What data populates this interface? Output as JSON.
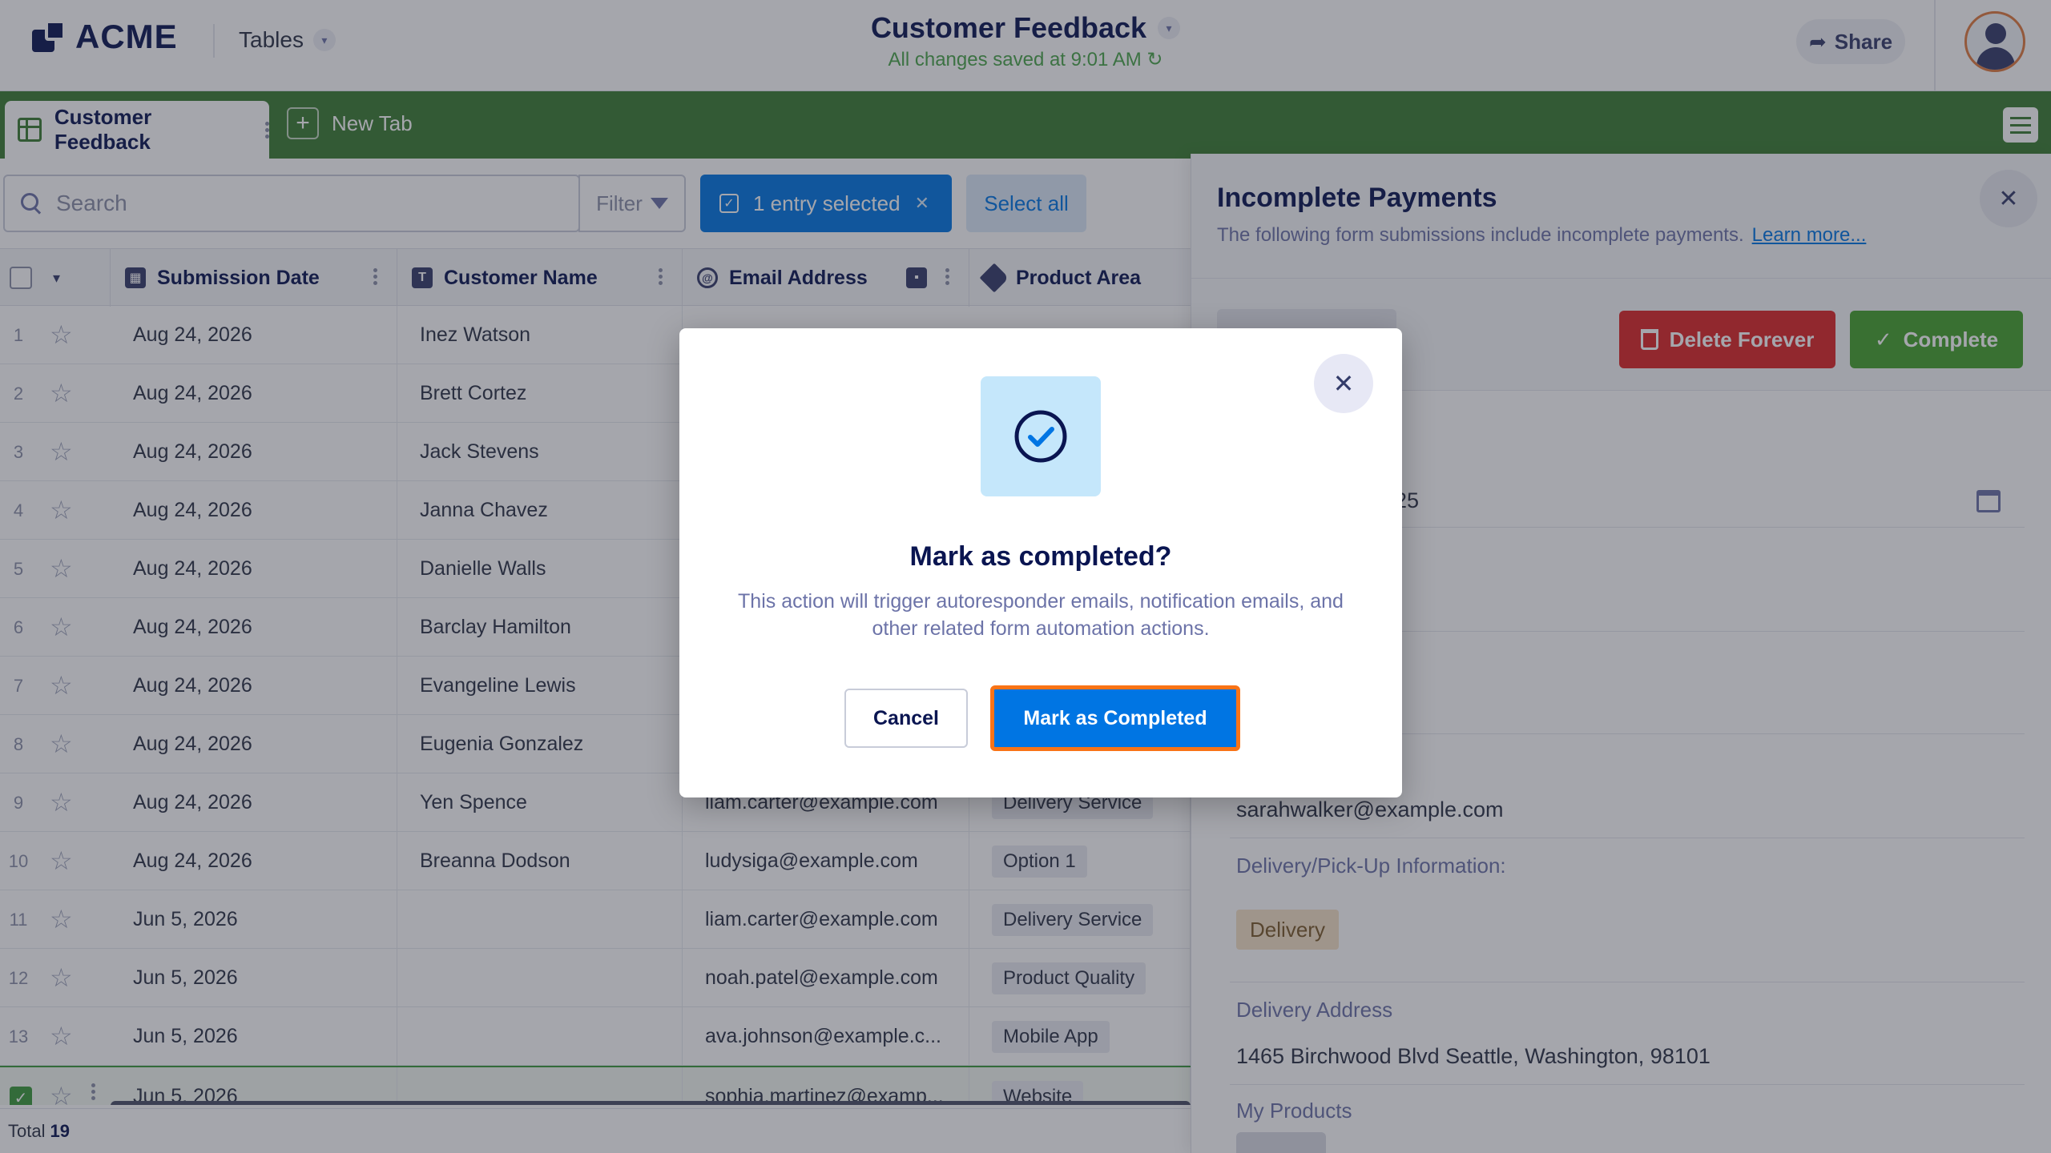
{
  "header": {
    "logo_text": "ACME",
    "tables_label": "Tables",
    "title": "Customer Feedback",
    "saved_status": "All changes saved at 9:01 AM",
    "share_label": "Share"
  },
  "tabs": {
    "active_label": "Customer Feedback",
    "new_tab_label": "New Tab"
  },
  "toolbar": {
    "search_placeholder": "Search",
    "filter_label": "Filter",
    "selection_label": "1 entry selected",
    "select_all_label": "Select all"
  },
  "table": {
    "columns": [
      "Submission Date",
      "Customer Name",
      "Email Address",
      "Product Area"
    ],
    "rows": [
      {
        "num": "1",
        "date": "Aug 24, 2026",
        "name": "Inez Watson",
        "email": "",
        "area": ""
      },
      {
        "num": "2",
        "date": "Aug 24, 2026",
        "name": "Brett Cortez",
        "email": "",
        "area": ""
      },
      {
        "num": "3",
        "date": "Aug 24, 2026",
        "name": "Jack Stevens",
        "email": "",
        "area": ""
      },
      {
        "num": "4",
        "date": "Aug 24, 2026",
        "name": "Janna Chavez",
        "email": "",
        "area": ""
      },
      {
        "num": "5",
        "date": "Aug 24, 2026",
        "name": "Danielle Walls",
        "email": "",
        "area": ""
      },
      {
        "num": "6",
        "date": "Aug 24, 2026",
        "name": "Barclay Hamilton",
        "email": "",
        "area": ""
      },
      {
        "num": "7",
        "date": "Aug 24, 2026",
        "name": "Evangeline Lewis",
        "email": "",
        "area": ""
      },
      {
        "num": "8",
        "date": "Aug 24, 2026",
        "name": "Eugenia Gonzalez",
        "email": "",
        "area": ""
      },
      {
        "num": "9",
        "date": "Aug 24, 2026",
        "name": "Yen Spence",
        "email": "liam.carter@example.com",
        "area": "Delivery Service"
      },
      {
        "num": "10",
        "date": "Aug 24, 2026",
        "name": "Breanna Dodson",
        "email": "ludysiga@example.com",
        "area": "Option 1"
      },
      {
        "num": "11",
        "date": "Jun 5, 2026",
        "name": "",
        "email": "liam.carter@example.com",
        "area": "Delivery Service"
      },
      {
        "num": "12",
        "date": "Jun 5, 2026",
        "name": "",
        "email": "noah.patel@example.com",
        "area": "Product Quality"
      },
      {
        "num": "13",
        "date": "Jun 5, 2026",
        "name": "",
        "email": "ava.johnson@example.c...",
        "area": "Mobile App"
      },
      {
        "num": "",
        "date": "Jun 5, 2026",
        "name": "",
        "email": "sophia.martinez@examp...",
        "area": "Website"
      }
    ],
    "footer_label": "Total",
    "footer_count": "19"
  },
  "panel": {
    "title": "Incomplete Payments",
    "subtitle": "The following form submissions include incomplete payments.",
    "learn_more": "Learn more...",
    "delete_label": "Delete Forever",
    "complete_label": "Complete",
    "partial_date": "25",
    "email_value": "sarahwalker@example.com",
    "delivery_info_label": "Delivery/Pick-Up Information:",
    "delivery_tag": "Delivery",
    "delivery_address_label": "Delivery Address",
    "delivery_address_value": "1465 Birchwood Blvd  Seattle, Washington, 98101",
    "products_label": "My Products"
  },
  "modal": {
    "title": "Mark as completed?",
    "text": "This action will trigger autoresponder emails, notification emails, and other related form automation actions.",
    "cancel_label": "Cancel",
    "confirm_label": "Mark as Completed"
  },
  "colors": {
    "brand_navy": "#0a1551",
    "tab_green": "#3b7d32",
    "primary_blue": "#0075e3",
    "danger_red": "#dc2626",
    "success_green": "#46a22e",
    "focus_orange": "#f97316"
  }
}
